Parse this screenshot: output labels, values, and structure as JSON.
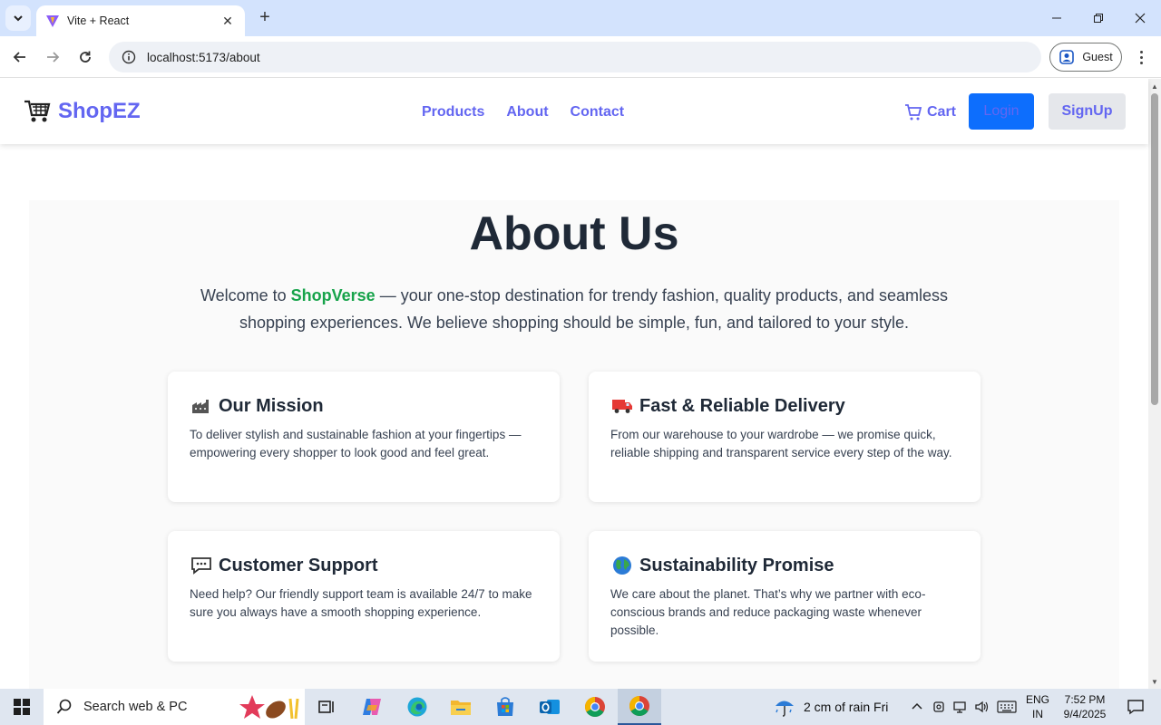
{
  "browser": {
    "tab_title": "Vite + React",
    "url": "localhost:5173/about",
    "profile_label": "Guest"
  },
  "site": {
    "brand": "ShopEZ",
    "nav": [
      "Products",
      "About",
      "Contact"
    ],
    "cart_label": "Cart",
    "login_label": "Login",
    "signup_label": "SignUp"
  },
  "about": {
    "title": "About Us",
    "intro_prefix": "Welcome to ",
    "intro_brand": "ShopVerse",
    "intro_suffix": " — your one-stop destination for trendy fashion, quality products, and seamless shopping experiences. We believe shopping should be simple, fun, and tailored to your style.",
    "cards": [
      {
        "icon": "factory-icon",
        "title": "Our Mission",
        "body": "To deliver stylish and sustainable fashion at your fingertips — empowering every shopper to look good and feel great."
      },
      {
        "icon": "truck-icon",
        "title": "Fast & Reliable Delivery",
        "body": "From our warehouse to your wardrobe — we promise quick, reliable shipping and transparent service every step of the way."
      },
      {
        "icon": "speech-bubble-icon",
        "title": "Customer Support",
        "body": "Need help? Our friendly support team is available 24/7 to make sure you always have a smooth shopping experience."
      },
      {
        "icon": "globe-icon",
        "title": "Sustainability Promise",
        "body": "We care about the planet. That’s why we partner with eco-conscious brands and reduce packaging waste whenever possible."
      }
    ]
  },
  "taskbar": {
    "search_placeholder": "Search web & PC",
    "weather": "2 cm of rain Fri",
    "lang_line1": "ENG",
    "lang_line2": "IN",
    "time": "7:52 PM",
    "date": "9/4/2025"
  },
  "colors": {
    "accent": "#6366f1",
    "login_bg": "#0d6efd",
    "brand_highlight": "#16a34a",
    "heading": "#1f2937"
  }
}
